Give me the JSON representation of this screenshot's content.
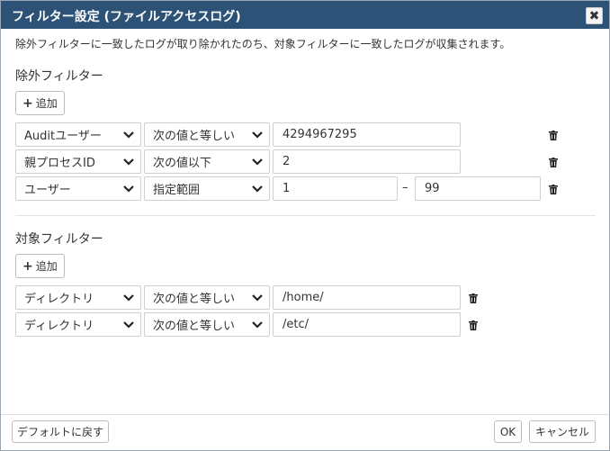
{
  "dialog": {
    "title": "フィルター設定 (ファイルアクセスログ)",
    "close_glyph": "✖",
    "description": "除外フィルターに一致したログが取り除かれたのち、対象フィルターに一致したログが収集されます。"
  },
  "exclude": {
    "title": "除外フィルター",
    "add_label": "追加",
    "rows": [
      {
        "field": "Auditユーザー",
        "op": "次の値と等しい",
        "value": "4294967295"
      },
      {
        "field": "親プロセスID",
        "op": "次の値以下",
        "value": "2"
      },
      {
        "field": "ユーザー",
        "op": "指定範囲",
        "value": "1",
        "value_to": "99",
        "separator": "–"
      }
    ]
  },
  "target": {
    "title": "対象フィルター",
    "add_label": "追加",
    "rows": [
      {
        "field": "ディレクトリ",
        "op": "次の値と等しい",
        "value": "/home/"
      },
      {
        "field": "ディレクトリ",
        "op": "次の値と等しい",
        "value": "/etc/"
      }
    ]
  },
  "footer": {
    "reset_label": "デフォルトに戻す",
    "ok_label": "OK",
    "cancel_label": "キャンセル"
  },
  "icons": {
    "plus": "plus-icon",
    "chevron": "chevron-down-icon",
    "trash": "trash-icon",
    "close": "close-icon"
  },
  "colors": {
    "titlebar": "#2d5277",
    "border": "#cfcfcf"
  }
}
